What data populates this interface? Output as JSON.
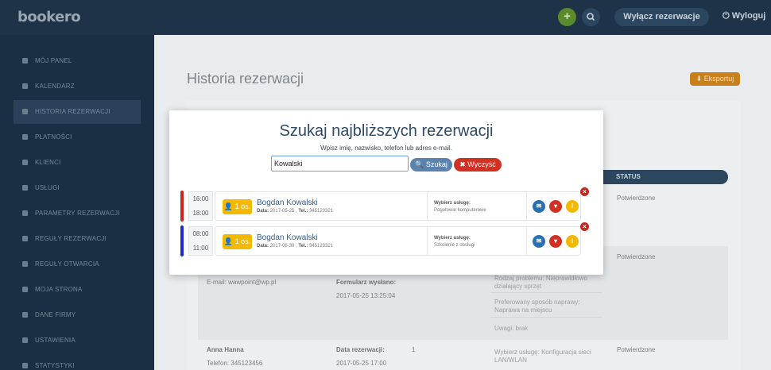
{
  "app": {
    "logo": "bookero"
  },
  "topbar": {
    "add_icon": "plus-icon",
    "search_icon": "search-icon",
    "disable_label": "Wyłącz rezerwacje",
    "logout_label": "⏻ Wyloguj"
  },
  "sidebar": {
    "items": [
      {
        "label": "MÓJ PANEL",
        "icon": "dashboard-icon"
      },
      {
        "label": "KALENDARZ",
        "icon": "calendar-icon"
      },
      {
        "label": "HISTORIA REZERWACJI",
        "icon": "history-icon",
        "active": true
      },
      {
        "label": "PŁATNOŚCI",
        "icon": "card-icon"
      },
      {
        "label": "KLIENCI",
        "icon": "users-icon"
      },
      {
        "label": "USŁUGI",
        "icon": "services-icon"
      },
      {
        "label": "PARAMETRY REZERWACJI",
        "icon": "wrench-icon"
      },
      {
        "label": "REGUŁY REZERWACJI",
        "icon": "rules-icon"
      },
      {
        "label": "REGUŁY OTWARCIA",
        "icon": "calendar-icon"
      },
      {
        "label": "MOJA STRONA",
        "icon": "page-icon"
      },
      {
        "label": "DANE FIRMY",
        "icon": "company-icon"
      },
      {
        "label": "USTAWIENIA",
        "icon": "gear-icon"
      },
      {
        "label": "STATYSTYKI",
        "icon": "stats-icon"
      }
    ]
  },
  "main": {
    "title": "Historia rezerwacji",
    "export_label": "⬇ Eksportuj",
    "status_header": "STATUS",
    "bg": {
      "status1": "Potwierdzone",
      "status2": "Potwierdzone",
      "status3": "Potwierdzone",
      "email": "E-mail: wawpoint@wp.pl",
      "form_sent_label": "Formularz wysłano:",
      "form_sent_value": "2017-05-25 13:25:04",
      "problem": "Rodzaj problemu: Nieprawidłowo działający sprzęt",
      "repair": "Preferowany sposób naprawy: Naprawa na miejscu",
      "notes": "Uwagi: brak",
      "client2_name": "Anna Hanna",
      "client2_phone": "Telefon: 345123456",
      "res_date_label": "Data rezerwacji:",
      "res_date_value": "2017-05-25 17:00",
      "res_count": "1",
      "service2": "Wybierz usługę: Konfiguracja sieci LAN/WLAN"
    }
  },
  "modal": {
    "title": "Szukaj najbliższych rezerwacji",
    "subtitle": "Wpisz imię, nazwisko, telefon lub adres e-mail.",
    "search_value": "Kowalski",
    "search_button": "🔍 Szukaj",
    "clear_button": "✖ Wyczyść",
    "results": [
      {
        "start": "16:00",
        "end": "18:00",
        "color": "#c8281c",
        "persons": "👤 1 os.",
        "name": "Bogdan Kowalski",
        "date_label": "Data:",
        "date": "2017-05-25",
        "tel_label": "Tel.:",
        "tel": "345123321",
        "service_label": "Wybierz usługę:",
        "service": "Pogotowie komputerowe"
      },
      {
        "start": "08:00",
        "end": "11:00",
        "color": "#1c2bd0",
        "persons": "👤 1 os.",
        "name": "Bogdan Kowalski",
        "date_label": "Data:",
        "date": "2017-06-30",
        "tel_label": "Tel.:",
        "tel": "345123321",
        "service_label": "Wybierz usługę:",
        "service": "Szkolenie z obsługi"
      }
    ]
  }
}
